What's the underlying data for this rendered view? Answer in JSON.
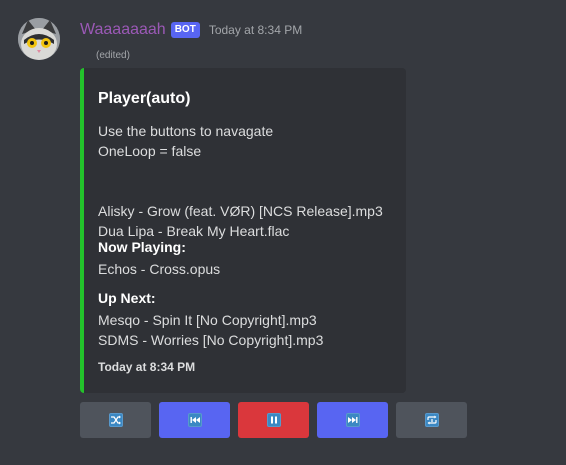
{
  "message": {
    "author": "Waaaaaaah",
    "bot_tag": "BOT",
    "timestamp": "Today at 8:34 PM",
    "edited": "(edited)",
    "avatar_icon": "cat-avatar-icon"
  },
  "embed": {
    "accent_color": "#23c22b",
    "title": "Player(auto)",
    "description_lines": [
      "Use the buttons to navagate",
      "OneLoop = false",
      "",
      "",
      "Alisky - Grow (feat. VØR) [NCS Release].mp3",
      "Dua Lipa - Break My Heart.flac"
    ],
    "fields": [
      {
        "name": "Now Playing:",
        "values": [
          "Echos - Cross.opus"
        ]
      },
      {
        "name": "Up Next:",
        "values": [
          "Mesqo - Spin It [No Copyright].mp3",
          "SDMS - Worries [No Copyright].mp3"
        ]
      }
    ],
    "footer": "Today at 8:34 PM"
  },
  "buttons": [
    {
      "icon": "shuffle-icon",
      "style": "secondary"
    },
    {
      "icon": "previous-track-icon",
      "style": "primary"
    },
    {
      "icon": "pause-icon",
      "style": "danger"
    },
    {
      "icon": "next-track-icon",
      "style": "primary"
    },
    {
      "icon": "repeat-one-icon",
      "style": "secondary"
    }
  ],
  "colors": {
    "background": "#36393f",
    "embed_background": "#2f3136",
    "username": "#9b59b6",
    "blurple": "#5865f2",
    "danger": "#da373c",
    "secondary": "#4f545c"
  }
}
